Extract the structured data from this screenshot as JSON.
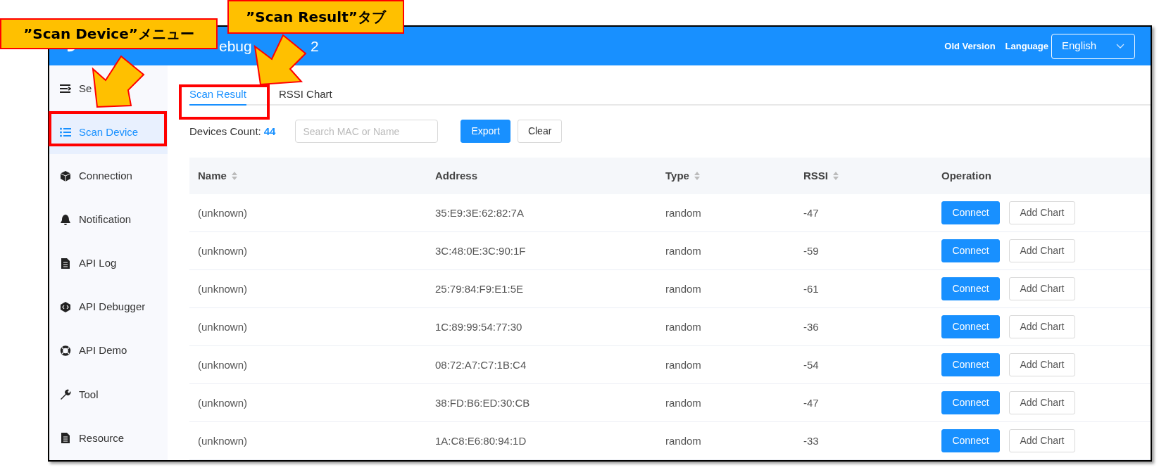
{
  "header": {
    "title_fragments": [
      "ebug",
      "2"
    ],
    "links": [
      "Old Version",
      "Language"
    ],
    "language_select": {
      "value": "English"
    }
  },
  "sidebar": {
    "items": [
      {
        "label": "Se",
        "selected": false
      },
      {
        "label": "Scan Device",
        "selected": true
      },
      {
        "label": "Connection",
        "selected": false
      },
      {
        "label": "Notification",
        "selected": false
      },
      {
        "label": "API Log",
        "selected": false
      },
      {
        "label": "API Debugger",
        "selected": false
      },
      {
        "label": "API Demo",
        "selected": false
      },
      {
        "label": "Tool",
        "selected": false
      },
      {
        "label": "Resource",
        "selected": false
      }
    ]
  },
  "tabs": [
    {
      "label": "Scan Result",
      "selected": true
    },
    {
      "label": "RSSI Chart",
      "selected": false
    }
  ],
  "toolbar": {
    "count_label": "Devices Count:",
    "count": "44",
    "search": {
      "placeholder": "Search MAC or Name"
    },
    "buttons": [
      {
        "label": "Export",
        "kind": "primary"
      },
      {
        "label": "Clear",
        "kind": "default"
      }
    ]
  },
  "table": {
    "columns": [
      {
        "label": "Name",
        "sortable": true
      },
      {
        "label": "Address",
        "sortable": false
      },
      {
        "label": "Type",
        "sortable": true
      },
      {
        "label": "RSSI",
        "sortable": true
      },
      {
        "label": "Operation",
        "sortable": false
      }
    ],
    "rows": [
      {
        "name": "(unknown)",
        "address": "35:E9:3E:62:82:7A",
        "type": "random",
        "rssi": "-47",
        "actions": [
          "Connect",
          "Add Chart"
        ]
      },
      {
        "name": "(unknown)",
        "address": "3C:48:0E:3C:90:1F",
        "type": "random",
        "rssi": "-59",
        "actions": [
          "Connect",
          "Add Chart"
        ]
      },
      {
        "name": "(unknown)",
        "address": "25:79:84:F9:E1:5E",
        "type": "random",
        "rssi": "-61",
        "actions": [
          "Connect",
          "Add Chart"
        ]
      },
      {
        "name": "(unknown)",
        "address": "1C:89:99:54:77:30",
        "type": "random",
        "rssi": "-36",
        "actions": [
          "Connect",
          "Add Chart"
        ]
      },
      {
        "name": "(unknown)",
        "address": "08:72:A7:C7:1B:C4",
        "type": "random",
        "rssi": "-54",
        "actions": [
          "Connect",
          "Add Chart"
        ]
      },
      {
        "name": "(unknown)",
        "address": "38:FD:B6:ED:30:CB",
        "type": "random",
        "rssi": "-47",
        "actions": [
          "Connect",
          "Add Chart"
        ]
      },
      {
        "name": "(unknown)",
        "address": "1A:C8:E6:80:94:1D",
        "type": "random",
        "rssi": "-33",
        "actions": [
          "Connect",
          "Add Chart"
        ]
      }
    ]
  },
  "annotations": [
    {
      "label": "”Scan Device”メニュー"
    },
    {
      "label": "”Scan Result”タブ"
    }
  ]
}
